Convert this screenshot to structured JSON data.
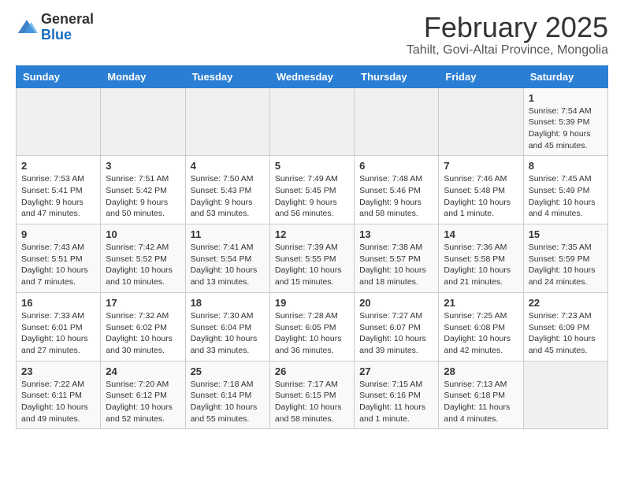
{
  "header": {
    "logo_general": "General",
    "logo_blue": "Blue",
    "month_title": "February 2025",
    "location": "Tahilt, Govi-Altai Province, Mongolia"
  },
  "days_of_week": [
    "Sunday",
    "Monday",
    "Tuesday",
    "Wednesday",
    "Thursday",
    "Friday",
    "Saturday"
  ],
  "weeks": [
    [
      {
        "num": "",
        "info": ""
      },
      {
        "num": "",
        "info": ""
      },
      {
        "num": "",
        "info": ""
      },
      {
        "num": "",
        "info": ""
      },
      {
        "num": "",
        "info": ""
      },
      {
        "num": "",
        "info": ""
      },
      {
        "num": "1",
        "info": "Sunrise: 7:54 AM\nSunset: 5:39 PM\nDaylight: 9 hours and 45 minutes."
      }
    ],
    [
      {
        "num": "2",
        "info": "Sunrise: 7:53 AM\nSunset: 5:41 PM\nDaylight: 9 hours and 47 minutes."
      },
      {
        "num": "3",
        "info": "Sunrise: 7:51 AM\nSunset: 5:42 PM\nDaylight: 9 hours and 50 minutes."
      },
      {
        "num": "4",
        "info": "Sunrise: 7:50 AM\nSunset: 5:43 PM\nDaylight: 9 hours and 53 minutes."
      },
      {
        "num": "5",
        "info": "Sunrise: 7:49 AM\nSunset: 5:45 PM\nDaylight: 9 hours and 56 minutes."
      },
      {
        "num": "6",
        "info": "Sunrise: 7:48 AM\nSunset: 5:46 PM\nDaylight: 9 hours and 58 minutes."
      },
      {
        "num": "7",
        "info": "Sunrise: 7:46 AM\nSunset: 5:48 PM\nDaylight: 10 hours and 1 minute."
      },
      {
        "num": "8",
        "info": "Sunrise: 7:45 AM\nSunset: 5:49 PM\nDaylight: 10 hours and 4 minutes."
      }
    ],
    [
      {
        "num": "9",
        "info": "Sunrise: 7:43 AM\nSunset: 5:51 PM\nDaylight: 10 hours and 7 minutes."
      },
      {
        "num": "10",
        "info": "Sunrise: 7:42 AM\nSunset: 5:52 PM\nDaylight: 10 hours and 10 minutes."
      },
      {
        "num": "11",
        "info": "Sunrise: 7:41 AM\nSunset: 5:54 PM\nDaylight: 10 hours and 13 minutes."
      },
      {
        "num": "12",
        "info": "Sunrise: 7:39 AM\nSunset: 5:55 PM\nDaylight: 10 hours and 15 minutes."
      },
      {
        "num": "13",
        "info": "Sunrise: 7:38 AM\nSunset: 5:57 PM\nDaylight: 10 hours and 18 minutes."
      },
      {
        "num": "14",
        "info": "Sunrise: 7:36 AM\nSunset: 5:58 PM\nDaylight: 10 hours and 21 minutes."
      },
      {
        "num": "15",
        "info": "Sunrise: 7:35 AM\nSunset: 5:59 PM\nDaylight: 10 hours and 24 minutes."
      }
    ],
    [
      {
        "num": "16",
        "info": "Sunrise: 7:33 AM\nSunset: 6:01 PM\nDaylight: 10 hours and 27 minutes."
      },
      {
        "num": "17",
        "info": "Sunrise: 7:32 AM\nSunset: 6:02 PM\nDaylight: 10 hours and 30 minutes."
      },
      {
        "num": "18",
        "info": "Sunrise: 7:30 AM\nSunset: 6:04 PM\nDaylight: 10 hours and 33 minutes."
      },
      {
        "num": "19",
        "info": "Sunrise: 7:28 AM\nSunset: 6:05 PM\nDaylight: 10 hours and 36 minutes."
      },
      {
        "num": "20",
        "info": "Sunrise: 7:27 AM\nSunset: 6:07 PM\nDaylight: 10 hours and 39 minutes."
      },
      {
        "num": "21",
        "info": "Sunrise: 7:25 AM\nSunset: 6:08 PM\nDaylight: 10 hours and 42 minutes."
      },
      {
        "num": "22",
        "info": "Sunrise: 7:23 AM\nSunset: 6:09 PM\nDaylight: 10 hours and 45 minutes."
      }
    ],
    [
      {
        "num": "23",
        "info": "Sunrise: 7:22 AM\nSunset: 6:11 PM\nDaylight: 10 hours and 49 minutes."
      },
      {
        "num": "24",
        "info": "Sunrise: 7:20 AM\nSunset: 6:12 PM\nDaylight: 10 hours and 52 minutes."
      },
      {
        "num": "25",
        "info": "Sunrise: 7:18 AM\nSunset: 6:14 PM\nDaylight: 10 hours and 55 minutes."
      },
      {
        "num": "26",
        "info": "Sunrise: 7:17 AM\nSunset: 6:15 PM\nDaylight: 10 hours and 58 minutes."
      },
      {
        "num": "27",
        "info": "Sunrise: 7:15 AM\nSunset: 6:16 PM\nDaylight: 11 hours and 1 minute."
      },
      {
        "num": "28",
        "info": "Sunrise: 7:13 AM\nSunset: 6:18 PM\nDaylight: 11 hours and 4 minutes."
      },
      {
        "num": "",
        "info": ""
      }
    ]
  ]
}
